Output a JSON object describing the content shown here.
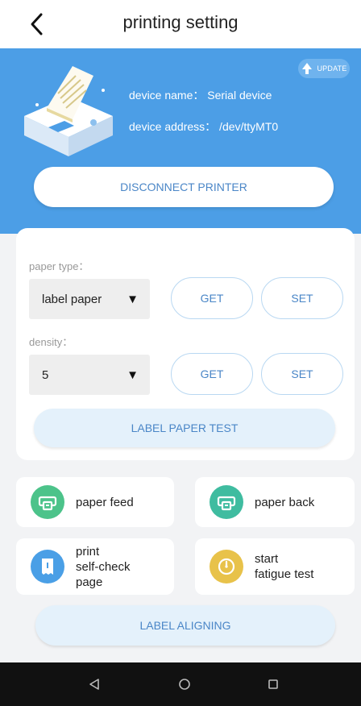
{
  "header": {
    "title": "printing setting"
  },
  "device": {
    "update_label": "UPDATE",
    "name_line": "device name： Serial device",
    "address_line": "device address： /dev/ttyMT0",
    "disconnect_label": "DISCONNECT PRINTER"
  },
  "settings": {
    "paper_type": {
      "label": "paper type：",
      "value": "label paper",
      "get_label": "GET",
      "set_label": "SET"
    },
    "density": {
      "label": "density：",
      "value": "5",
      "get_label": "GET",
      "set_label": "SET"
    },
    "label_paper_test_label": "LABEL PAPER TEST"
  },
  "actions": [
    {
      "label": "paper feed",
      "icon": "printer-feed-icon",
      "color": "#4cc38a"
    },
    {
      "label": "paper back",
      "icon": "printer-back-icon",
      "color": "#3fbca0"
    },
    {
      "label": "print\nself-check\npage",
      "icon": "receipt-icon",
      "color": "#4a9fe6"
    },
    {
      "label": "start\nfatigue test",
      "icon": "gauge-icon",
      "color": "#e8c24a"
    }
  ],
  "label_aligning_label": "LABEL ALIGNING",
  "colors": {
    "hero": "#4c9ee6",
    "accent_text": "#4a86c7",
    "light_button": "#e4f1fb"
  }
}
